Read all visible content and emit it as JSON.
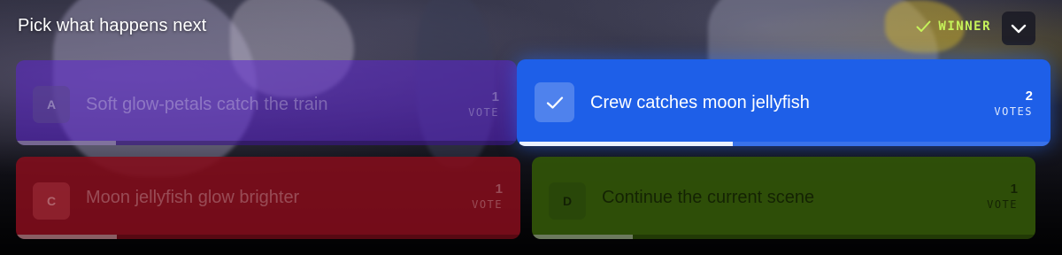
{
  "poll": {
    "title": "Pick what happens next",
    "winner_label": "WINNER",
    "options": [
      {
        "letter": "A",
        "label": "Soft glow-petals catch the train",
        "votes": "1",
        "unit": "VOTE",
        "share": 0.5,
        "color": "#5c24d2",
        "is_winner": false
      },
      {
        "letter": "",
        "label": "Crew catches moon jellyfish",
        "votes": "2",
        "unit": "VOTES",
        "share": 1.0,
        "color": "#1e5fe8",
        "is_winner": true
      },
      {
        "letter": "C",
        "label": "Moon jellyfish glow brighter",
        "votes": "1",
        "unit": "VOTE",
        "share": 0.5,
        "color": "#840e1c",
        "is_winner": false
      },
      {
        "letter": "D",
        "label": "Continue the current scene",
        "votes": "1",
        "unit": "VOTE",
        "share": 0.5,
        "color": "#305208",
        "is_winner": false
      }
    ]
  },
  "colors": {
    "winner_accent": "#c6f35a"
  },
  "icons": {
    "winner": "checkmark-icon",
    "collapse": "chevron-down-icon",
    "selected": "checkmark-icon"
  }
}
